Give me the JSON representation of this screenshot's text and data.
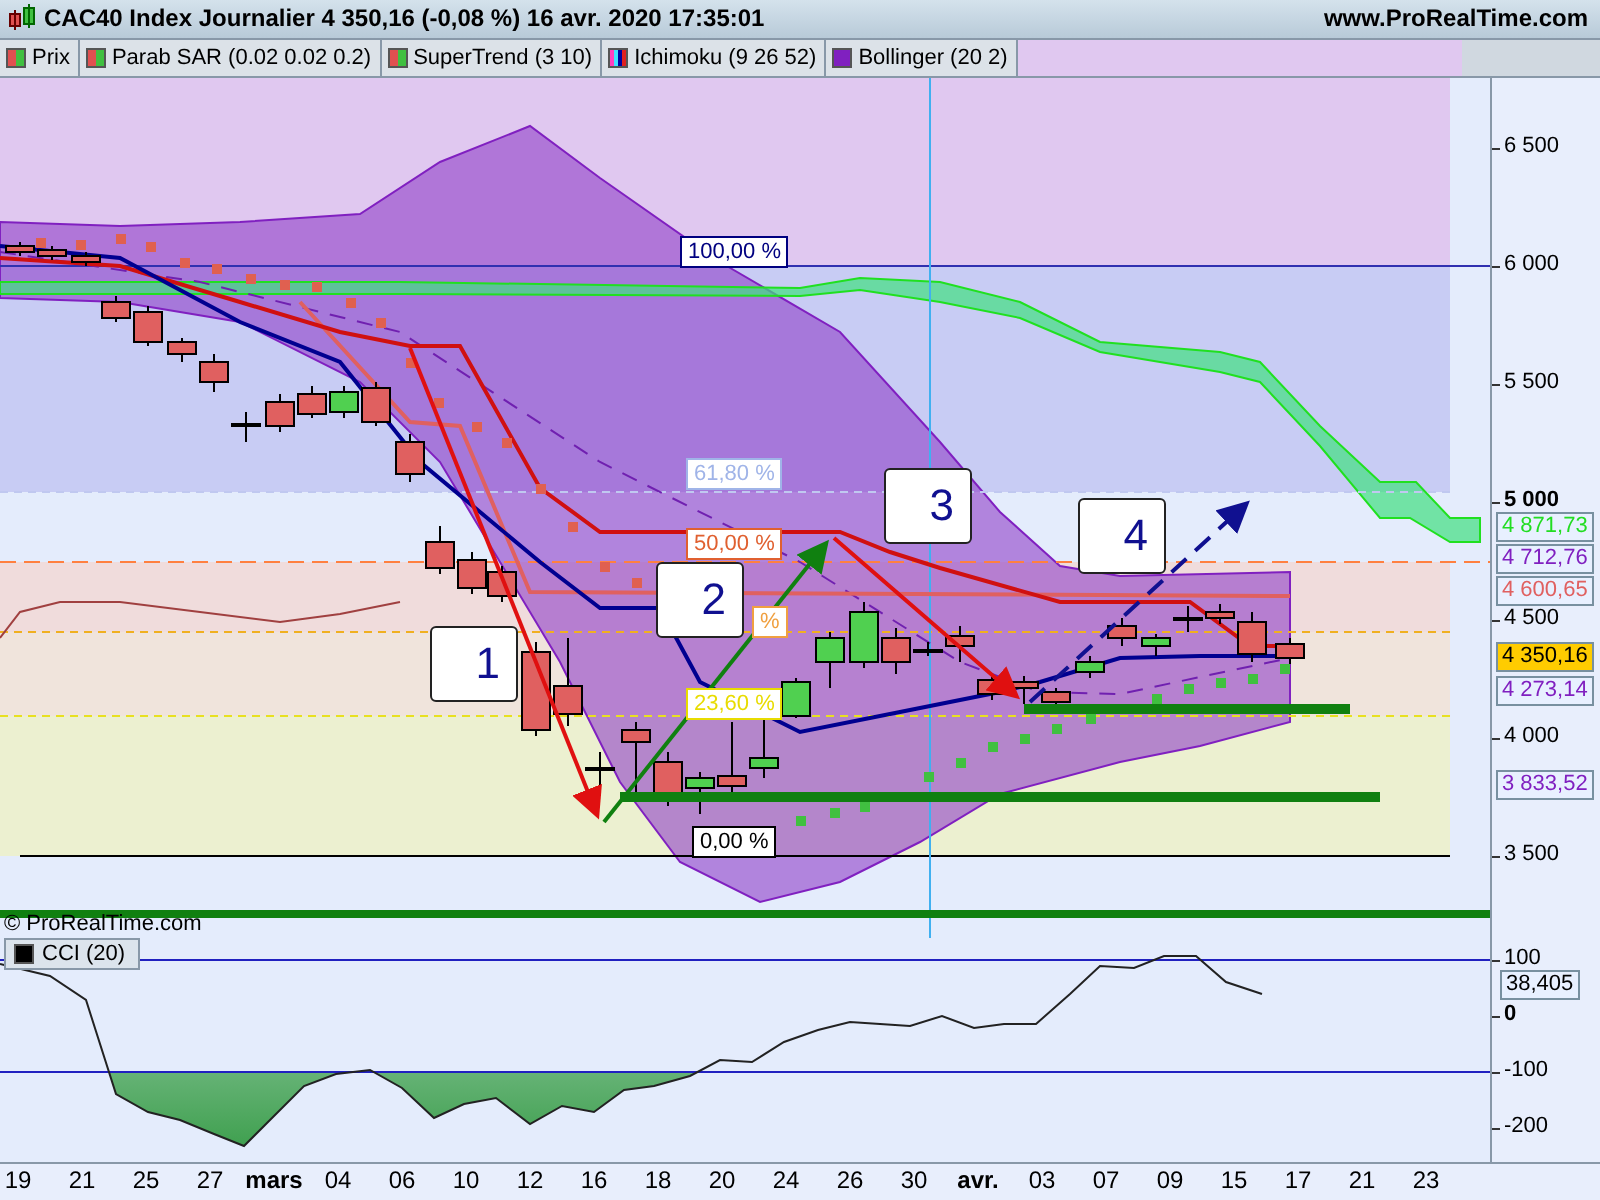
{
  "window": {
    "title": "CAC40 Index Journalier 4 350,16 (-0,08 %) 16 avr. 2020 17:35:01",
    "site": "www.ProRealTime.com"
  },
  "legend": [
    {
      "label": "Prix",
      "kind": "candles"
    },
    {
      "label": "Parab SAR (0.02 0.02 0.2)",
      "kind": "sar"
    },
    {
      "label": "SuperTrend (3 10)",
      "kind": "supertrend"
    },
    {
      "label": "Ichimoku (9 26 52)",
      "kind": "ichimoku"
    },
    {
      "label": "Bollinger (20 2)",
      "kind": "bollinger"
    }
  ],
  "price_panel": {
    "copyright": "© ProRealTime.com",
    "fib_labels": [
      {
        "text": "100,00 %",
        "color": "#000080"
      },
      {
        "text": "61,80 %",
        "color": "#a0b4e8"
      },
      {
        "text": "50,00 %",
        "color": "#e06030"
      },
      {
        "text": "%",
        "color": "#f0a040"
      },
      {
        "text": "23,60 %",
        "color": "#e8dc00"
      },
      {
        "text": "0,00 %",
        "color": "#000000"
      }
    ],
    "wave_labels": [
      "1",
      "2",
      "3",
      "4"
    ],
    "y_ticks": [
      {
        "label": "6 500",
        "bold": false
      },
      {
        "label": "6 000",
        "bold": false
      },
      {
        "label": "5 500",
        "bold": false
      },
      {
        "label": "5 000",
        "bold": true
      },
      {
        "label": "4 500",
        "bold": false
      },
      {
        "label": "4 000",
        "bold": false
      },
      {
        "label": "3 500",
        "bold": false
      }
    ],
    "price_tags": [
      {
        "value": "4 871,73",
        "color": "#22dd22",
        "kind": "level"
      },
      {
        "value": "4 712,76",
        "color": "#8020c0",
        "kind": "level"
      },
      {
        "value": "4 600,65",
        "color": "#e06060",
        "kind": "level"
      },
      {
        "value": "4 350,16",
        "color": "#ffcc00",
        "kind": "current"
      },
      {
        "value": "4 273,14",
        "color": "#8020c0",
        "kind": "level"
      },
      {
        "value": "3 833,52",
        "color": "#8020c0",
        "kind": "level"
      }
    ]
  },
  "cci_panel": {
    "label": "CCI (20)",
    "reading": "38,405",
    "y_ticks": [
      {
        "label": "100",
        "bold": false
      },
      {
        "label": "0",
        "bold": true
      },
      {
        "label": "-100",
        "bold": false
      },
      {
        "label": "-200",
        "bold": false
      }
    ]
  },
  "x_axis": [
    {
      "label": "19",
      "bold": false
    },
    {
      "label": "21",
      "bold": false
    },
    {
      "label": "25",
      "bold": false
    },
    {
      "label": "27",
      "bold": false
    },
    {
      "label": "mars",
      "bold": true
    },
    {
      "label": "04",
      "bold": false
    },
    {
      "label": "06",
      "bold": false
    },
    {
      "label": "10",
      "bold": false
    },
    {
      "label": "12",
      "bold": false
    },
    {
      "label": "16",
      "bold": false
    },
    {
      "label": "18",
      "bold": false
    },
    {
      "label": "20",
      "bold": false
    },
    {
      "label": "24",
      "bold": false
    },
    {
      "label": "26",
      "bold": false
    },
    {
      "label": "30",
      "bold": false
    },
    {
      "label": "avr.",
      "bold": true
    },
    {
      "label": "03",
      "bold": false
    },
    {
      "label": "07",
      "bold": false
    },
    {
      "label": "09",
      "bold": false
    },
    {
      "label": "15",
      "bold": false
    },
    {
      "label": "17",
      "bold": false
    },
    {
      "label": "21",
      "bold": false
    },
    {
      "label": "23",
      "bold": false
    }
  ]
}
